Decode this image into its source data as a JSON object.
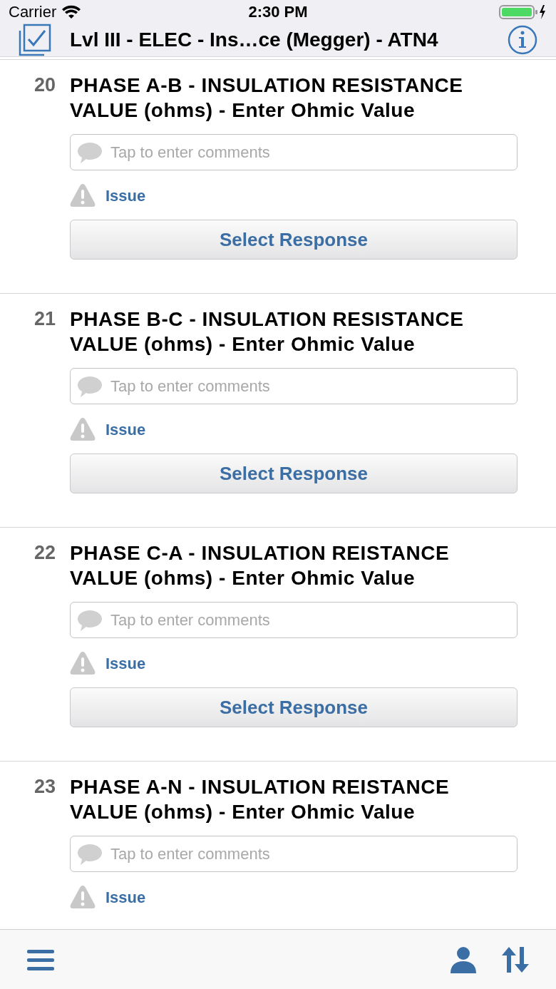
{
  "status_bar": {
    "carrier": "Carrier",
    "time": "2:30 PM"
  },
  "nav_bar": {
    "title": "Lvl III - ELEC - Ins…ce (Megger) - ATN4"
  },
  "questions": [
    {
      "number": "20",
      "title": "PHASE A-B - INSULATION RESISTANCE VALUE (ohms) - Enter Ohmic Value",
      "comment_placeholder": "Tap to enter comments",
      "issue_label": "Issue",
      "response_button": "Select Response"
    },
    {
      "number": "21",
      "title": "PHASE B-C - INSULATION RESISTANCE VALUE (ohms) - Enter Ohmic Value",
      "comment_placeholder": "Tap to enter comments",
      "issue_label": "Issue",
      "response_button": "Select Response"
    },
    {
      "number": "22",
      "title": "PHASE C-A - INSULATION REISTANCE VALUE (ohms) - Enter Ohmic Value",
      "comment_placeholder": "Tap to enter comments",
      "issue_label": "Issue",
      "response_button": "Select Response"
    },
    {
      "number": "23",
      "title": "PHASE A-N - INSULATION REISTANCE VALUE (ohms) - Enter Ohmic Value",
      "comment_placeholder": "Tap to enter comments",
      "issue_label": "Issue"
    }
  ]
}
